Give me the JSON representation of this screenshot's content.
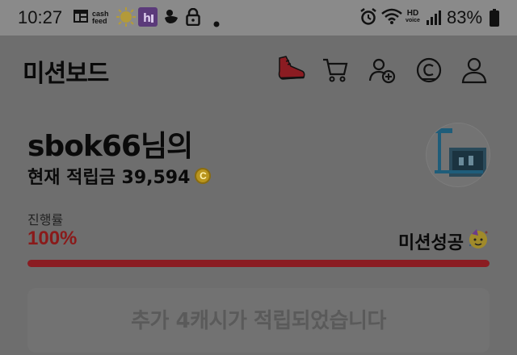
{
  "status_bar": {
    "time": "10:27",
    "cashfeed_top": "cash",
    "cashfeed_bottom": "feed",
    "hd_top": "HD",
    "hd_bottom": "voice",
    "battery": "83%"
  },
  "header": {
    "title": "미션보드"
  },
  "profile": {
    "username": "sbok66님의",
    "balance_label": "현재 적립금 39,594",
    "coin_symbol": "C"
  },
  "progress": {
    "label": "진행률",
    "percent_text": "100%",
    "value": 1.0,
    "status": "미션성공"
  },
  "reward": {
    "message": "추가 4캐시가 적립되었습니다"
  },
  "colors": {
    "accent_red": "#8b1c22",
    "overlay_dim": "#6e6e6e"
  }
}
